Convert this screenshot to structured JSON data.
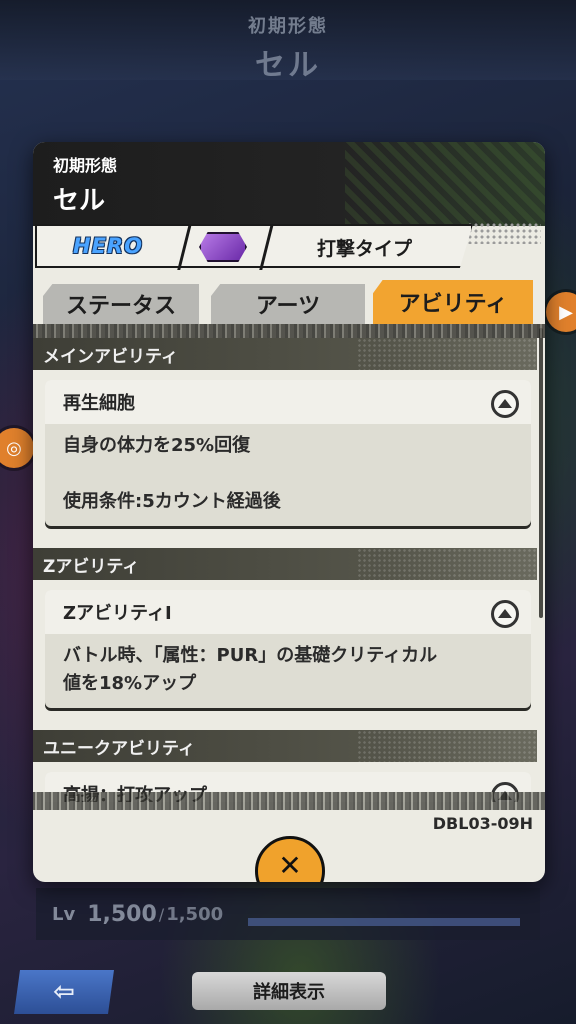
{
  "background": {
    "form_label": "初期形態",
    "name": "セル"
  },
  "modal": {
    "form_label": "初期形態",
    "name": "セル",
    "hero_badge": "HERO",
    "type": "打撃タイプ",
    "tabs": [
      {
        "label": "ステータス",
        "active": false
      },
      {
        "label": "アーツ",
        "active": false
      },
      {
        "label": "アビリティ",
        "active": true
      }
    ],
    "sections": [
      {
        "title": "メインアビリティ",
        "card": {
          "name": "再生細胞",
          "lines": [
            "自身の体力を25%回復",
            "",
            "使用条件:5カウント経過後"
          ]
        }
      },
      {
        "title": "Zアビリティ",
        "card": {
          "name": "ZアビリティI",
          "lines": [
            "バトル時、「属性：PUR」の基礎クリティカル",
            "値を18%アップ"
          ]
        }
      },
      {
        "title": "ユニークアビリティ",
        "card": {
          "name": "高揚：打攻アップ",
          "lines": []
        }
      }
    ],
    "card_code": "DBL03-09H",
    "close_label": "✕"
  },
  "level": {
    "label": "Lv",
    "current": "1,500",
    "separator": "/",
    "max": "1,500"
  },
  "bottom_nav": {
    "back_label": "⇦",
    "detail_label": "詳細表示"
  },
  "colors": {
    "accent_orange": "#f2a430",
    "hero_blue": "#4aa3ff",
    "crystal_purple": "#8a3fd0",
    "panel": "#ecebe3"
  }
}
